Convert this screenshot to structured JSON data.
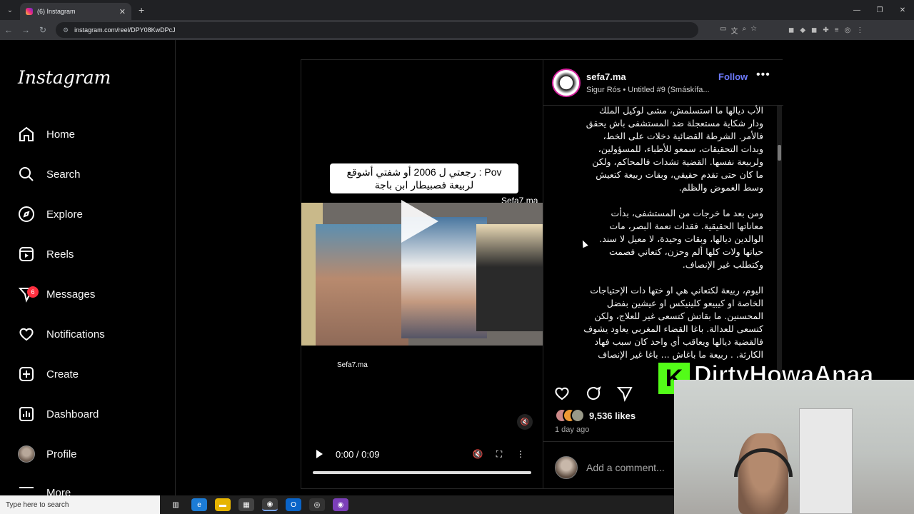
{
  "browser": {
    "tab_title": "(6) Instagram",
    "url": "instagram.com/reel/DPY08KwDPcJ"
  },
  "sidebar": {
    "logo": "Instagram",
    "items": [
      {
        "label": "Home",
        "icon": "home-icon"
      },
      {
        "label": "Search",
        "icon": "search-icon"
      },
      {
        "label": "Explore",
        "icon": "compass-icon"
      },
      {
        "label": "Reels",
        "icon": "reels-icon"
      },
      {
        "label": "Messages",
        "icon": "messenger-icon",
        "badge": "6"
      },
      {
        "label": "Notifications",
        "icon": "heart-icon"
      },
      {
        "label": "Create",
        "icon": "plus-square-icon"
      },
      {
        "label": "Dashboard",
        "icon": "chart-icon"
      },
      {
        "label": "Profile",
        "icon": "avatar"
      }
    ],
    "more_label": "More"
  },
  "video": {
    "overlay_text_line1": "رجعتي ل 2006 أو شفتي أشوقع : Pov",
    "overlay_text_line2": "لربيعة فصبيطار ابن باجة",
    "watermark": "Sefa7.ma",
    "watermark_bottom": "Sefa7.ma",
    "time": "0:00 / 0:09",
    "progress": 0
  },
  "post": {
    "username": "sefa7.ma",
    "follow_label": "Follow",
    "audio": "Sigur Rós • Untitled #9 (Smáskífa...",
    "caption_paragraphs": [
      "الأب ديالها ما استسلمش، مشى لوكيل الملك ودار شكاية مستعجلة ضد المستشفى باش يحقق فالأمر. الشرطة القضائية دخلات على الخط، وبدات التحقيقات، سمعو للأطباء، للمسؤولين، ولربيعة نفسها. القضية تشدات فالمحاكم، ولكن ما كان حتى تقدم حقيقي، وبقات ربيعة كتعيش وسط الغموض والظلم.",
      "ومن بعد ما خرجات من المستشفى، بدأت معاناتها الحقيقية. فقدات نعمة البصر، مات الوالدين ديالها، وبقات وحيدة، لا معيل لا سند. حياتها ولات كلها ألم وحزن، كتعاني فصمت وكتطلب غير الإنصاف.",
      "اليوم، ربيعة لكتعاني هي او ختها دات الإحتياجات الخاصة او كيبيعو كلينيكس او عيشين بفضل المحسنين. ما بقاتش كتسعى غير للعلاج، ولكن كتسعى للعدالة. باغا القضاء المغربي يعاود يشوف فالقضية ديالها ويعاقب أي واحد كان سبب فهاد الكارثة. . ربيعة ما باغاش ... باغا غير الإنصاف"
    ],
    "likes": "9,536 likes",
    "time_ago": "1 day ago",
    "comment_placeholder": "Add a comment..."
  },
  "overlay": {
    "kick_letter": "K",
    "streamer_name": "DirtyHowaAnaa"
  },
  "taskbar": {
    "search_placeholder": "Type here to search"
  },
  "colors": {
    "accent_follow": "#6e7bff",
    "kick_green": "#53fc18",
    "badge_red": "#ff3040"
  }
}
